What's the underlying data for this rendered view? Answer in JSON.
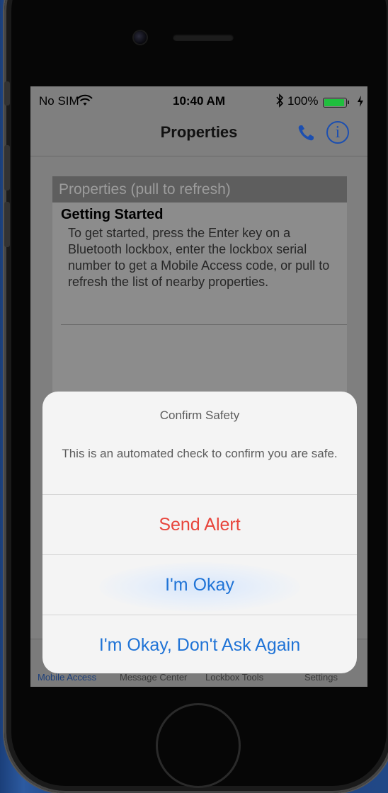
{
  "status_bar": {
    "carrier": "No SIM",
    "time": "10:40 AM",
    "battery": "100%",
    "icons": [
      "wifi-icon",
      "bluetooth-icon",
      "battery-icon",
      "charging-icon"
    ]
  },
  "nav": {
    "title": "Properties",
    "icons": [
      "phone-icon",
      "info-icon"
    ],
    "info_glyph": "i"
  },
  "properties_list": {
    "header": "Properties (pull to refresh)",
    "getting_started": {
      "title": "Getting Started",
      "text": "To get started, press the Enter key on a Bluetooth lockbox, enter the lockbox serial number to get a Mobile Access code, or pull to refresh the list of nearby properties."
    }
  },
  "tab_bar": {
    "tabs": [
      {
        "label": "Mobile Access"
      },
      {
        "label": "Message Center"
      },
      {
        "label": "Lockbox Tools"
      },
      {
        "label": "Settings"
      }
    ]
  },
  "alert": {
    "title": "Confirm Safety",
    "message": "This is an automated check to confirm you are safe.",
    "buttons": [
      {
        "label": "Send Alert",
        "style": "destructive"
      },
      {
        "label": "I'm Okay",
        "style": "default",
        "highlighted": true
      },
      {
        "label": "I'm Okay, Don't Ask Again",
        "style": "default"
      }
    ]
  },
  "colors": {
    "accent_blue": "#1f73d6",
    "destructive_red": "#e8453c",
    "battery_green": "#1fbf3d",
    "dim_overlay": "#7f7f7f"
  }
}
